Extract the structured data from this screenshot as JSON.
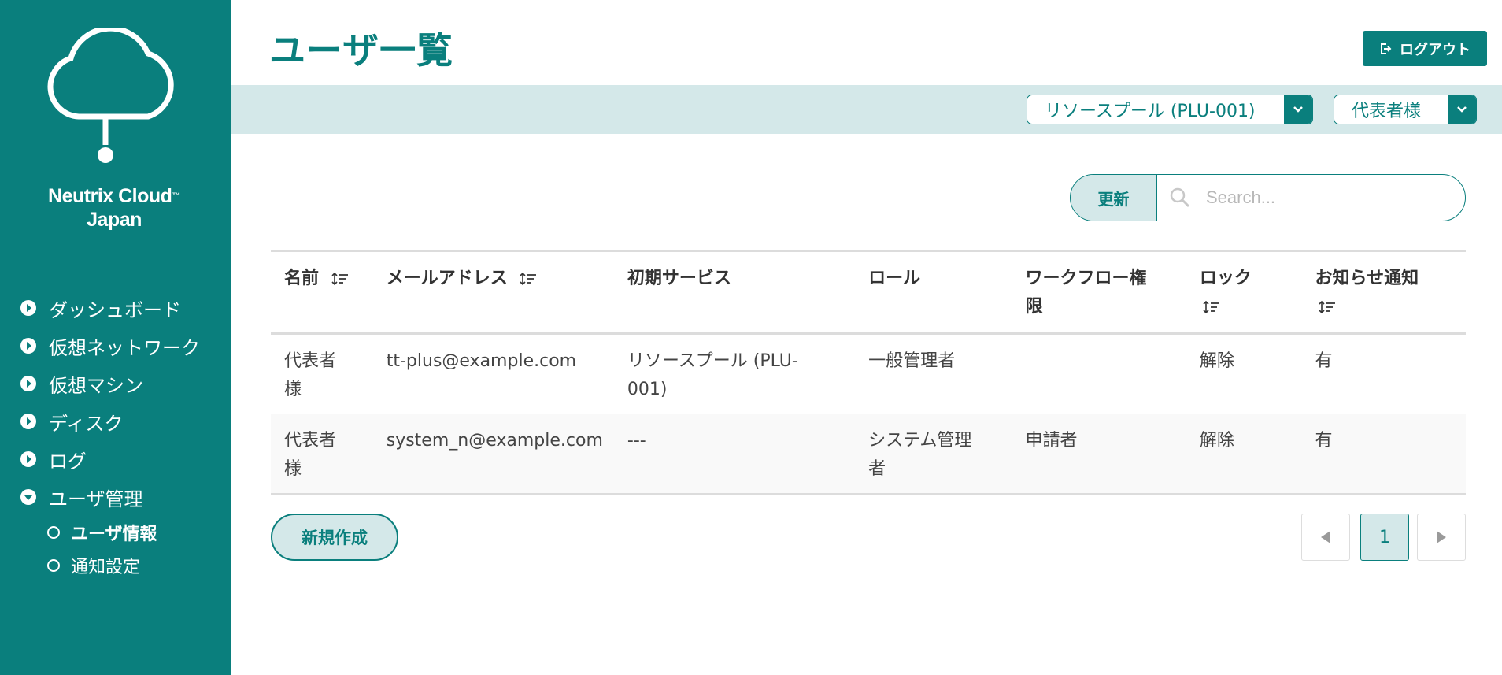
{
  "colors": {
    "brand": "#0a7f7d",
    "band": "#d4e8e9"
  },
  "sidebar": {
    "brand_line1": "Neutrix Cloud",
    "brand_tm": "™",
    "brand_line2": "Japan",
    "items": [
      {
        "label": "ダッシュボード",
        "icon": "chevron-right-circle-icon"
      },
      {
        "label": "仮想ネットワーク",
        "icon": "chevron-right-circle-icon"
      },
      {
        "label": "仮想マシン",
        "icon": "chevron-right-circle-icon"
      },
      {
        "label": "ディスク",
        "icon": "chevron-right-circle-icon"
      },
      {
        "label": "ログ",
        "icon": "chevron-right-circle-icon"
      },
      {
        "label": "ユーザ管理",
        "icon": "chevron-down-circle-icon"
      }
    ],
    "subitems": [
      {
        "label": "ユーザ情報",
        "active": true
      },
      {
        "label": "通知設定",
        "active": false
      }
    ]
  },
  "header": {
    "title": "ユーザ一覧",
    "logout_label": "ログアウト"
  },
  "filters": {
    "resource_pool": "リソースプール (PLU-001)",
    "user": "代表者様"
  },
  "toolbar": {
    "refresh_label": "更新",
    "search_placeholder": "Search..."
  },
  "table": {
    "headers": {
      "name": "名前",
      "email": "メールアドレス",
      "service": "初期サービス",
      "role": "ロール",
      "workflow_line1": "ワークフロー権",
      "workflow_line2": "限",
      "lock": "ロック",
      "notify": "お知らせ通知"
    },
    "rows": [
      {
        "name_line1": "代表者",
        "name_line2": "様",
        "email": "tt-plus@example.com",
        "service_line1": "リソースプール (PLU-",
        "service_line2": "001)",
        "role_line1": "一般管理者",
        "role_line2": "",
        "workflow": "",
        "lock": "解除",
        "notify": "有"
      },
      {
        "name_line1": "代表者",
        "name_line2": "様",
        "email": "system_n@example.com",
        "service_line1": "---",
        "service_line2": "",
        "role_line1": "システム管理",
        "role_line2": "者",
        "workflow": "申請者",
        "lock": "解除",
        "notify": "有"
      }
    ]
  },
  "actions": {
    "new_label": "新規作成"
  },
  "pagination": {
    "current": "1"
  }
}
